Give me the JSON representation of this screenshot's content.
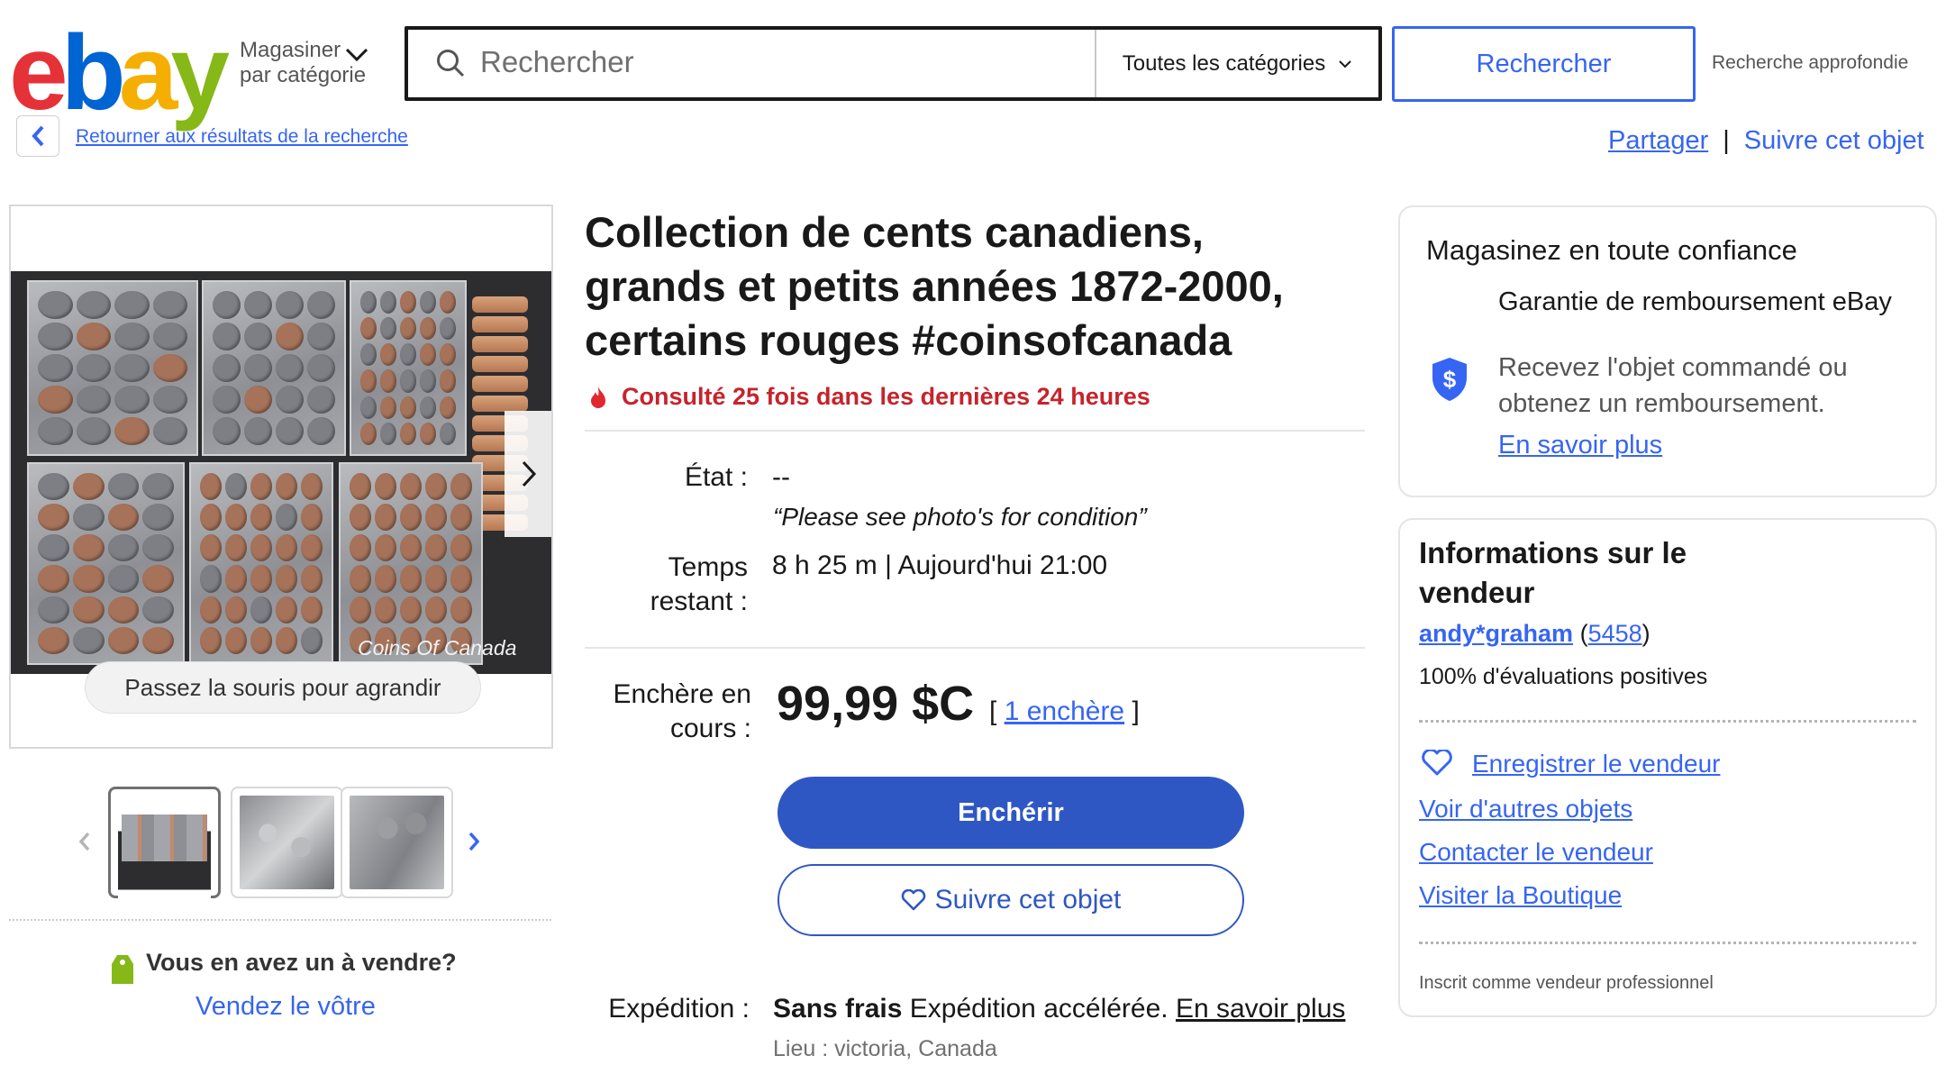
{
  "header": {
    "logo": "ebay",
    "shop_by_label": "Magasiner par catégorie",
    "search_placeholder": "Rechercher",
    "category_select": "Toutes les catégories",
    "search_button": "Rechercher",
    "advanced_search": "Recherche approfondie"
  },
  "nav": {
    "back_link": "Retourner aux résultats de la recherche",
    "share": "Partager",
    "separator": "|",
    "watch_item": "Suivre cet objet"
  },
  "gallery": {
    "watermark": "Coins Of Canada",
    "zoom_hint": "Passez la souris pour agrandir",
    "thumbnails": [
      "Photo 1",
      "Photo 2",
      "Photo 3"
    ],
    "sell_question": "Vous en avez un à vendre?",
    "sell_link": "Vendez le vôtre"
  },
  "listing": {
    "title": "Collection de cents canadiens, grands et petits années 1872-2000, certains rouges #coinsofcanada",
    "views": "Consulté 25 fois dans les dernières 24 heures",
    "condition_label": "État :",
    "condition_value": "--",
    "condition_note": "“Please see photo's for condition”",
    "time_label": "Temps restant :",
    "time_value": "8 h 25 m | Aujourd'hui 21:00",
    "bid_label": "Enchère en cours :",
    "price": "99,99 $C",
    "bids_open": "[",
    "bids_link": "1 enchère",
    "bids_close": "]",
    "bid_button": "Enchérir",
    "watch_button": "Suivre cet objet",
    "shipping_label": "Expédition :",
    "shipping_free": "Sans frais",
    "shipping_method": "Expédition accélérée.",
    "shipping_more": "En savoir plus",
    "location": "Lieu : victoria, Canada"
  },
  "confidence": {
    "title": "Magasinez en toute confiance",
    "guarantee_title": "Garantie de remboursement eBay",
    "guarantee_desc": "Recevez l'objet commandé ou obtenez un remboursement.",
    "learn_more": "En savoir plus"
  },
  "seller": {
    "title": "Informations sur le vendeur",
    "name": "andy*graham",
    "feedback_count": "5458",
    "positive": "100% d'évaluations positives",
    "save_seller": "Enregistrer le vendeur",
    "other_items": "Voir d'autres objets",
    "contact": "Contacter le vendeur",
    "store": "Visiter la Boutique",
    "pro_seller": "Inscrit comme vendeur professionnel"
  },
  "colors": {
    "accent": "#3665f3",
    "bid_button": "#2f57c4",
    "views_red": "#c7232b"
  }
}
